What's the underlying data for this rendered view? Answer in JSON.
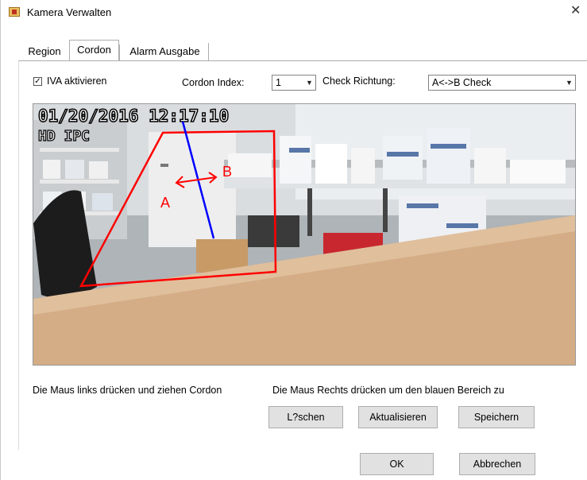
{
  "window": {
    "title": "Kamera Verwalten"
  },
  "tabs": [
    {
      "label": "Region"
    },
    {
      "label": "Cordon"
    },
    {
      "label": "Alarm Ausgabe"
    }
  ],
  "controls": {
    "iva_checkbox": {
      "checked_mark": "✓",
      "label": "IVA aktivieren"
    },
    "cordon_index": {
      "label": "Cordon Index:",
      "value": "1"
    },
    "check_direction": {
      "label": "Check Richtung:",
      "value": "A<->B Check"
    }
  },
  "video": {
    "timestamp": "01/20/2016 12:17:10",
    "overlay_text": "HD IPC",
    "cordon_labels": {
      "a": "A",
      "b": "B"
    }
  },
  "hints": {
    "left": "Die Maus links drücken und ziehen Cordon",
    "right": "Die Maus Rechts drücken um den blauen Bereich zu"
  },
  "buttons": {
    "delete": "L?schen",
    "refresh": "Aktualisieren",
    "save": "Speichern",
    "ok": "OK",
    "cancel": "Abbrechen"
  },
  "colors": {
    "cordon_line": "#ff0000",
    "direction_line": "#0000ff"
  }
}
